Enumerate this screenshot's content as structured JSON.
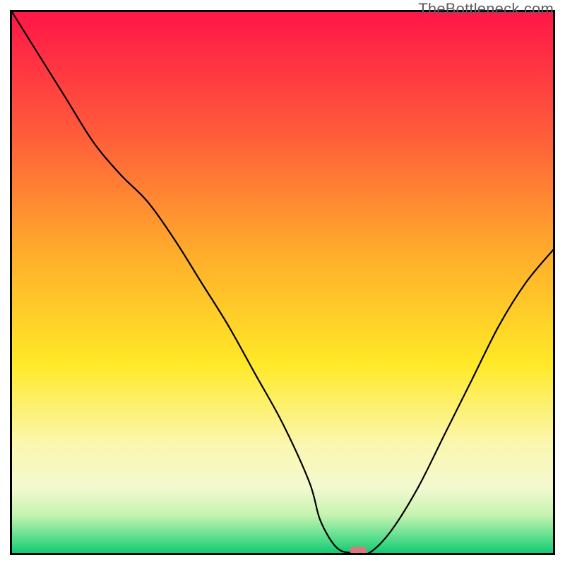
{
  "watermark": "TheBottleneck.com",
  "chart_data": {
    "type": "line",
    "title": "",
    "xlabel": "",
    "ylabel": "",
    "xlim": [
      0,
      100
    ],
    "ylim": [
      0,
      100
    ],
    "background": "vertical-gradient red→orange→yellow→pale-yellow→green",
    "series": [
      {
        "name": "bottleneck-curve",
        "x": [
          0,
          5,
          10,
          15,
          20,
          25,
          30,
          35,
          40,
          45,
          50,
          55,
          57,
          60,
          63,
          66,
          70,
          75,
          80,
          85,
          90,
          95,
          100
        ],
        "y": [
          100,
          92,
          84,
          76,
          70,
          65,
          58,
          50,
          42,
          33,
          24,
          13,
          6,
          1,
          0,
          0,
          4,
          12,
          22,
          32,
          42,
          50,
          56
        ]
      }
    ],
    "marker": {
      "x": 64,
      "y": 0,
      "color": "#d9777e"
    },
    "gradient_stops": [
      {
        "pct": 0,
        "color": "#ff1648"
      },
      {
        "pct": 22,
        "color": "#ff5a3a"
      },
      {
        "pct": 45,
        "color": "#ffae2b"
      },
      {
        "pct": 65,
        "color": "#ffe927"
      },
      {
        "pct": 80,
        "color": "#fbf7b0"
      },
      {
        "pct": 88,
        "color": "#f3f9d0"
      },
      {
        "pct": 93,
        "color": "#c6f3b0"
      },
      {
        "pct": 97,
        "color": "#5ee08e"
      },
      {
        "pct": 100,
        "color": "#14c974"
      }
    ]
  }
}
